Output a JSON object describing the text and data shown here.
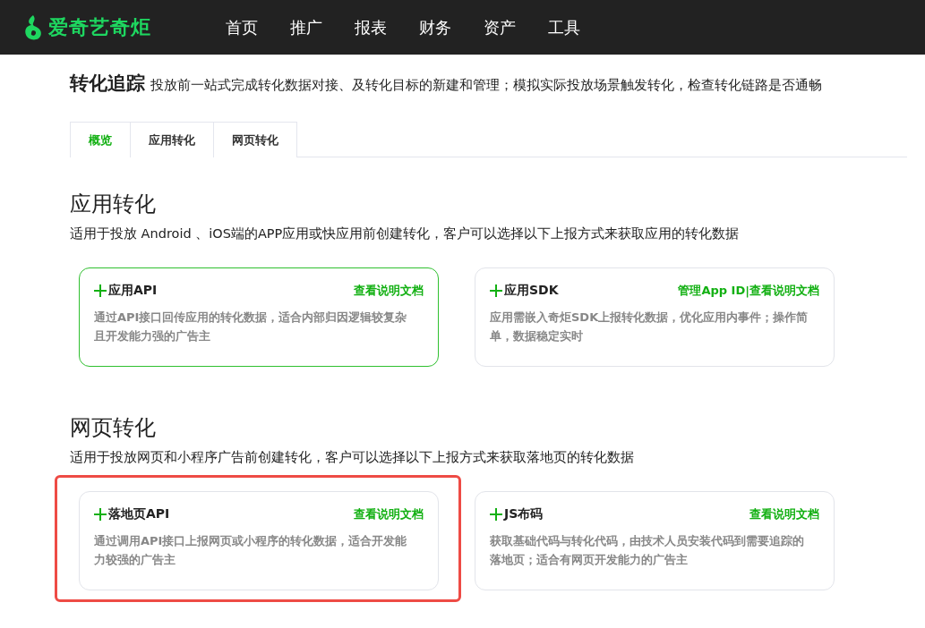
{
  "header": {
    "logo": "爱奇艺奇炬",
    "nav": [
      {
        "label": "首页",
        "selected": false
      },
      {
        "label": "推广",
        "selected": false
      },
      {
        "label": "报表",
        "selected": false
      },
      {
        "label": "财务",
        "selected": false
      },
      {
        "label": "资产",
        "selected": false
      },
      {
        "label": "工具",
        "selected": false
      }
    ]
  },
  "page": {
    "title": "转化追踪",
    "subtitle": "投放前一站式完成转化数据对接、及转化目标的新建和管理；模拟实际投放场景触发转化，检查转化链路是否通畅"
  },
  "tabs": [
    {
      "label": "概览",
      "selected": true
    },
    {
      "label": "应用转化",
      "selected": false
    },
    {
      "label": "网页转化",
      "selected": false
    }
  ],
  "sections": [
    {
      "heading": "应用转化",
      "description": "适用于投放 Android 、iOS端的APP应用或快应用前创建转化，客户可以选择以下上报方式来获取应用的转化数据",
      "cards": [
        {
          "title": "应用API",
          "links": [
            "查看说明文档"
          ],
          "description": "通过API接口回传应用的转化数据，适合内部归因逻辑较复杂且开发能力强的广告主",
          "selected": true,
          "highlighted": false
        },
        {
          "title": "应用SDK",
          "links": [
            "管理App ID",
            "查看说明文档"
          ],
          "link_separator": "|",
          "description": "应用需嵌入奇炬SDK上报转化数据，优化应用内事件；操作简单，数据稳定实时",
          "selected": false,
          "highlighted": false
        }
      ]
    },
    {
      "heading": "网页转化",
      "description": "适用于投放网页和小程序广告前创建转化，客户可以选择以下上报方式来获取落地页的转化数据",
      "cards": [
        {
          "title": "落地页API",
          "links": [
            "查看说明文档"
          ],
          "description": "通过调用API接口上报网页或小程序的转化数据，适合开发能力较强的广告主",
          "selected": false,
          "highlighted": true
        },
        {
          "title": "JS布码",
          "links": [
            "查看说明文档"
          ],
          "description": "获取基础代码与转化代码，由技术人员安装代码到需要追踪的落地页；适合有网页开发能力的广告主",
          "selected": false,
          "highlighted": false
        }
      ]
    }
  ]
}
